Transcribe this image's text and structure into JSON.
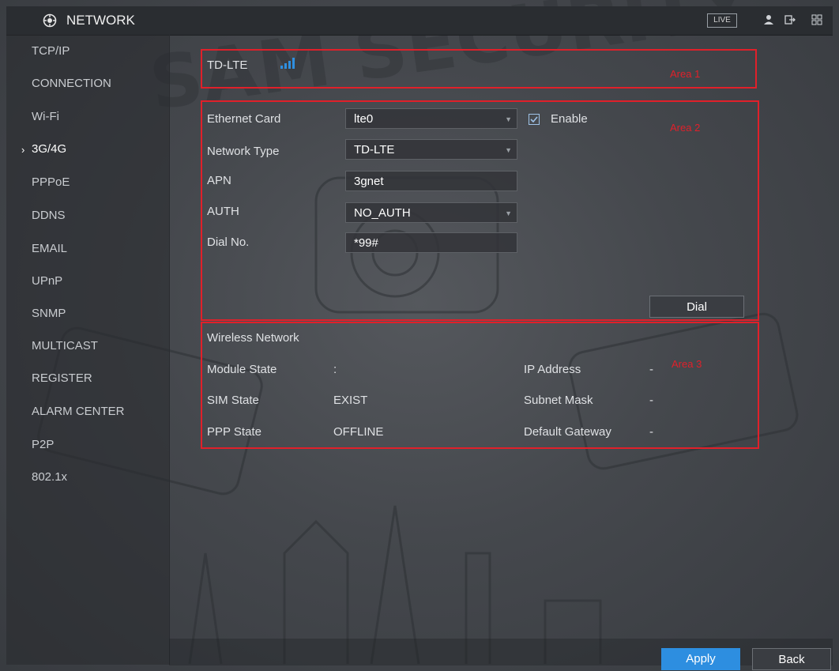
{
  "header": {
    "title": "NETWORK",
    "live_label": "LIVE"
  },
  "watermark": "SAM SECURITY",
  "sidebar": {
    "items": [
      {
        "label": "TCP/IP"
      },
      {
        "label": "CONNECTION"
      },
      {
        "label": "Wi-Fi"
      },
      {
        "label": "3G/4G",
        "active": true
      },
      {
        "label": "PPPoE"
      },
      {
        "label": "DDNS"
      },
      {
        "label": "EMAIL"
      },
      {
        "label": "UPnP"
      },
      {
        "label": "SNMP"
      },
      {
        "label": "MULTICAST"
      },
      {
        "label": "REGISTER"
      },
      {
        "label": "ALARM CENTER"
      },
      {
        "label": "P2P"
      },
      {
        "label": "802.1x"
      }
    ]
  },
  "area1": {
    "network_label": "TD-LTE",
    "area_label": "Area 1"
  },
  "area2": {
    "area_label": "Area 2",
    "ethernet_card_label": "Ethernet Card",
    "ethernet_card_value": "lte0",
    "enable_label": "Enable",
    "enable_checked": true,
    "network_type_label": "Network Type",
    "network_type_value": "TD-LTE",
    "apn_label": "APN",
    "apn_value": "3gnet",
    "auth_label": "AUTH",
    "auth_value": "NO_AUTH",
    "dial_no_label": "Dial No.",
    "dial_no_value": "*99#",
    "dial_button": "Dial"
  },
  "area3": {
    "area_label": "Area 3",
    "section_title": "Wireless Network",
    "module_state_label": "Module State",
    "module_state_value": ":",
    "sim_state_label": "SIM State",
    "sim_state_value": "EXIST",
    "ppp_state_label": "PPP State",
    "ppp_state_value": "OFFLINE",
    "ip_address_label": "IP Address",
    "ip_address_value": "-",
    "subnet_mask_label": "Subnet Mask",
    "subnet_mask_value": "-",
    "default_gateway_label": "Default Gateway",
    "default_gateway_value": "-"
  },
  "footer": {
    "apply_button": "Apply",
    "back_button": "Back"
  },
  "colors": {
    "accent": "#2d8ee0",
    "area_border": "#e0202a",
    "signal": "#2f8fe0"
  },
  "icons": [
    "network-gear-icon",
    "user-icon",
    "logout-icon",
    "grid-icon",
    "signal-bars-icon",
    "checkbox-check-icon",
    "chevron-right-icon"
  ]
}
